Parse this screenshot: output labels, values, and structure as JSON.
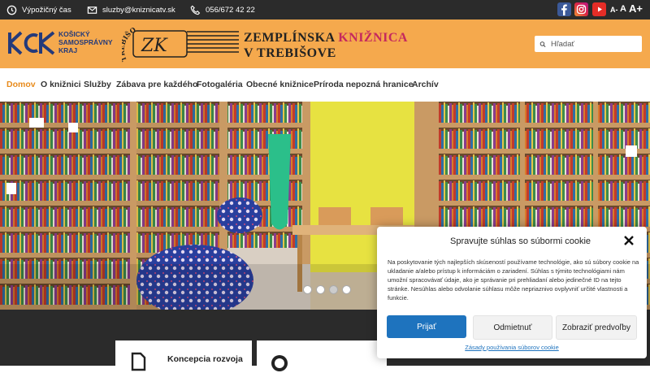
{
  "topbar": {
    "hours_label": "Výpožičný čas",
    "email": "sluzby@kniznicatv.sk",
    "phone": "056/672 42 22",
    "font_small": "A-",
    "font_normal": "A",
    "font_large": "A+",
    "social": [
      "facebook-icon",
      "instagram-icon",
      "youtube-icon"
    ]
  },
  "header": {
    "kraj_line1": "KOŠICKÝ",
    "kraj_line2": "SAMOSPRÁVNY",
    "kraj_line3": "KRAJ",
    "zk_initials": "ZK",
    "zk_arc": "TREBIŠOV",
    "title_part1": "ZEMPLÍNSKA ",
    "title_accent": "KNIŽNICA",
    "title_line2": "V TREBIŠOVE",
    "brand_color": "#f5a94d",
    "accent_color": "#c5295e"
  },
  "search": {
    "placeholder": "Hľadať"
  },
  "nav": {
    "items": [
      {
        "label": "Domov"
      },
      {
        "label": "O knižnici"
      },
      {
        "label": "Služby"
      },
      {
        "label": "Zábava pre každého"
      },
      {
        "label": "Fotogaléria"
      },
      {
        "label": "Obecné knižnice"
      },
      {
        "label": "Príroda nepozná hranice"
      },
      {
        "label": "Archív"
      }
    ],
    "active_color": "#e88b1c"
  },
  "hero": {
    "slides": 4,
    "active_slide": 3
  },
  "cards": [
    {
      "label": "Koncepcia rozvoja",
      "icon": "document-icon"
    },
    {
      "label": "",
      "icon": "globe-icon"
    }
  ],
  "cookie": {
    "title": "Spravujte súhlas so súbormi cookie",
    "text": "Na poskytovanie tých najlepších skúseností používame technológie, ako sú súbory cookie na ukladanie a/alebo prístup k informáciám o zariadení. Súhlas s týmito technológiami nám umožní spracovávať údaje, ako je správanie pri prehliadaní alebo jedinečné ID na tejto stránke. Nesúhlas alebo odvolanie súhlasu môže nepriaznivo ovplyvniť určité vlastnosti a funkcie.",
    "accept": "Prijať",
    "deny": "Odmietnuť",
    "preferences": "Zobraziť predvoľby",
    "policy_link": "Zásady používania súborov cookie",
    "accept_color": "#1e73be"
  }
}
